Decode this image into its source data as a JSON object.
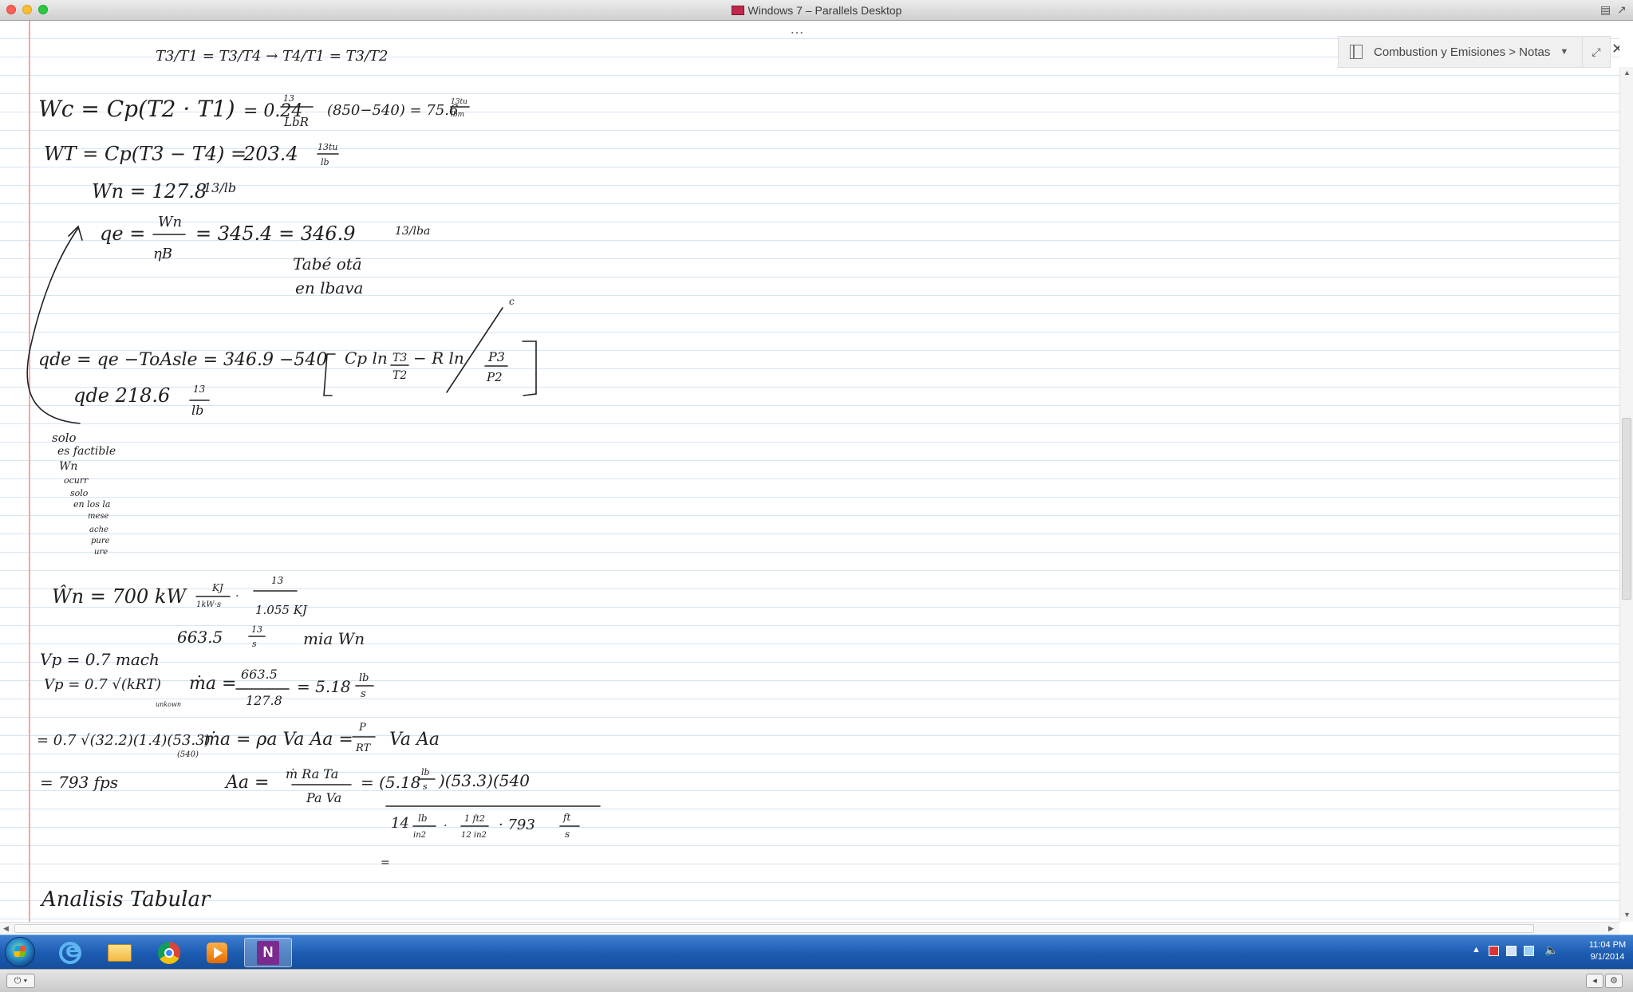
{
  "window": {
    "title": "Windows 7 – Parallels Desktop",
    "more_label": "…",
    "close_label": "✕"
  },
  "notebook": {
    "breadcrumb": "Combustion y Emisiones > Notas",
    "dropdown_icon": "chevron-down-icon",
    "expand_icon": "expand-icon"
  },
  "notes": {
    "l01": "T3/T1 = T3/T4  →  T4/T1 = T3/T2",
    "l02a": "Wc = Cp(T2 · T1)",
    "l02b": "= 0.24",
    "l02c": "(850−540) = 75.6",
    "l03a": "WT = Cp(T3 − T4) =",
    "l03b": "203.4",
    "l04": "Wn = 127.8",
    "l04u": "13/lb",
    "l05a": "qe =",
    "l05b": "= 345.4 = 346.9",
    "l05u": "13/lba",
    "l06": "Tabé otā",
    "l07": "en lbava",
    "l08a": "qde = qe −ToAsle = 346.9 −540",
    "l08b": "Cp ln",
    "l08c": "− R ln",
    "l09a": "qde  218.6",
    "side": [
      "solo",
      "es factible",
      "Wn",
      "ocurr",
      "solo",
      "en los la",
      "mese",
      "ache",
      "pure",
      "ure"
    ],
    "l10a": "Ŵn = 700 kW",
    "l11a": "663.5",
    "l11b": "mia Wn",
    "l12": "Vp = 0.7 mach",
    "l13a": "Vp = 0.7 √(kRT)",
    "l13b": "ṁa =",
    "l13c": "= 5.18",
    "l13n": "unkown",
    "l14a": "= 0.7 √(32.2)(1.4)(53.3)",
    "l14b": "ṁa = ρa Va Aa =",
    "l14c": "Va Aa",
    "l15a": "= 793 fps",
    "l15b": "Aa =",
    "l15c": "= (5.18",
    "l15d": ")(53.3)(540",
    "l16a": "14",
    "l16b": "· 793",
    "l17": "Analisis Tabular"
  },
  "taskbar": {
    "apps": [
      {
        "name": "Internet Explorer",
        "icon": "ie-icon"
      },
      {
        "name": "Windows Explorer",
        "icon": "folder-icon"
      },
      {
        "name": "Google Chrome",
        "icon": "chrome-icon"
      },
      {
        "name": "Windows Media Player",
        "icon": "media-player-icon"
      },
      {
        "name": "OneNote",
        "icon": "onenote-icon",
        "active": true
      }
    ],
    "onenote_glyph": "N",
    "clock_time": "11:04 PM",
    "clock_date": "9/1/2014",
    "tray_arrow": "▲"
  },
  "parallels": {
    "power_label": "⏻ ▾",
    "back_label": "◂",
    "gear_label": "⚙"
  }
}
